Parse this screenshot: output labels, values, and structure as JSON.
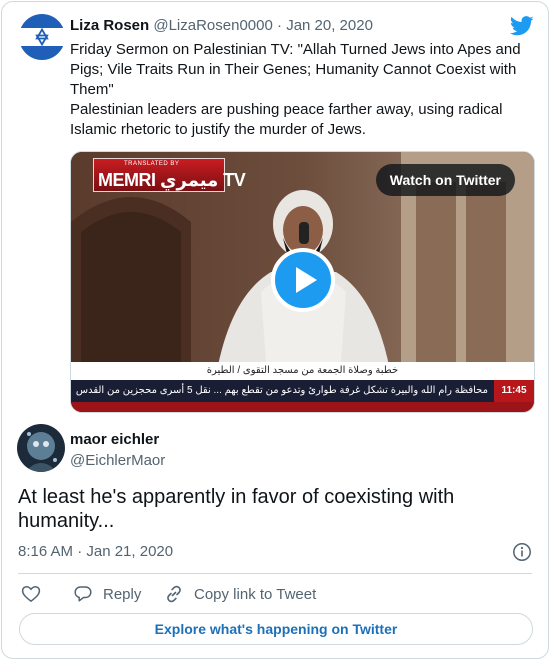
{
  "quoted_tweet": {
    "author_name": "Liza Rosen",
    "handle": "@LizaRosen0000",
    "separator": "·",
    "date": "Jan 20, 2020",
    "text_lines": [
      "Friday Sermon on Palestinian TV: \"Allah Turned Jews into Apes and Pigs; Vile Traits Run in Their Genes; Humanity Cannot Coexist with Them\"",
      "Palestinian leaders are pushing peace farther away, using radical Islamic rhetoric to justify the murder of Jews."
    ],
    "media": {
      "watch_label": "Watch on Twitter",
      "logo_small": "TRANSLATED BY",
      "logo_main": "MEMRI ميمري TV",
      "caption": "خطبة وصلاة الجمعة من مسجد التقوى / الطيرة",
      "ticker_text": "محافظة رام الله والبيرة تشكل غرفة طوارئ وتدعو من تقطع بهم ... نقل 5 أسرى محجزين من القدس",
      "ticker_time": "11:45"
    }
  },
  "reply_tweet": {
    "author_name": "maor eichler",
    "handle": "@EichlerMaor",
    "text": "At least he's apparently in favor of coexisting with humanity...",
    "time": "8:16 AM · Jan 21, 2020"
  },
  "actions": {
    "reply_label": "Reply",
    "copy_label": "Copy link to Tweet"
  },
  "explore_label": "Explore what's happening on Twitter",
  "colors": {
    "twitter_blue": "#1d9bf0",
    "link_blue": "#1d70b8",
    "secondary_text": "#536471",
    "border": "#cfd9de"
  },
  "icons": [
    "israel-flag-avatar",
    "twitter-bird-icon",
    "play-icon",
    "info-icon",
    "heart-icon",
    "reply-icon",
    "link-icon"
  ]
}
